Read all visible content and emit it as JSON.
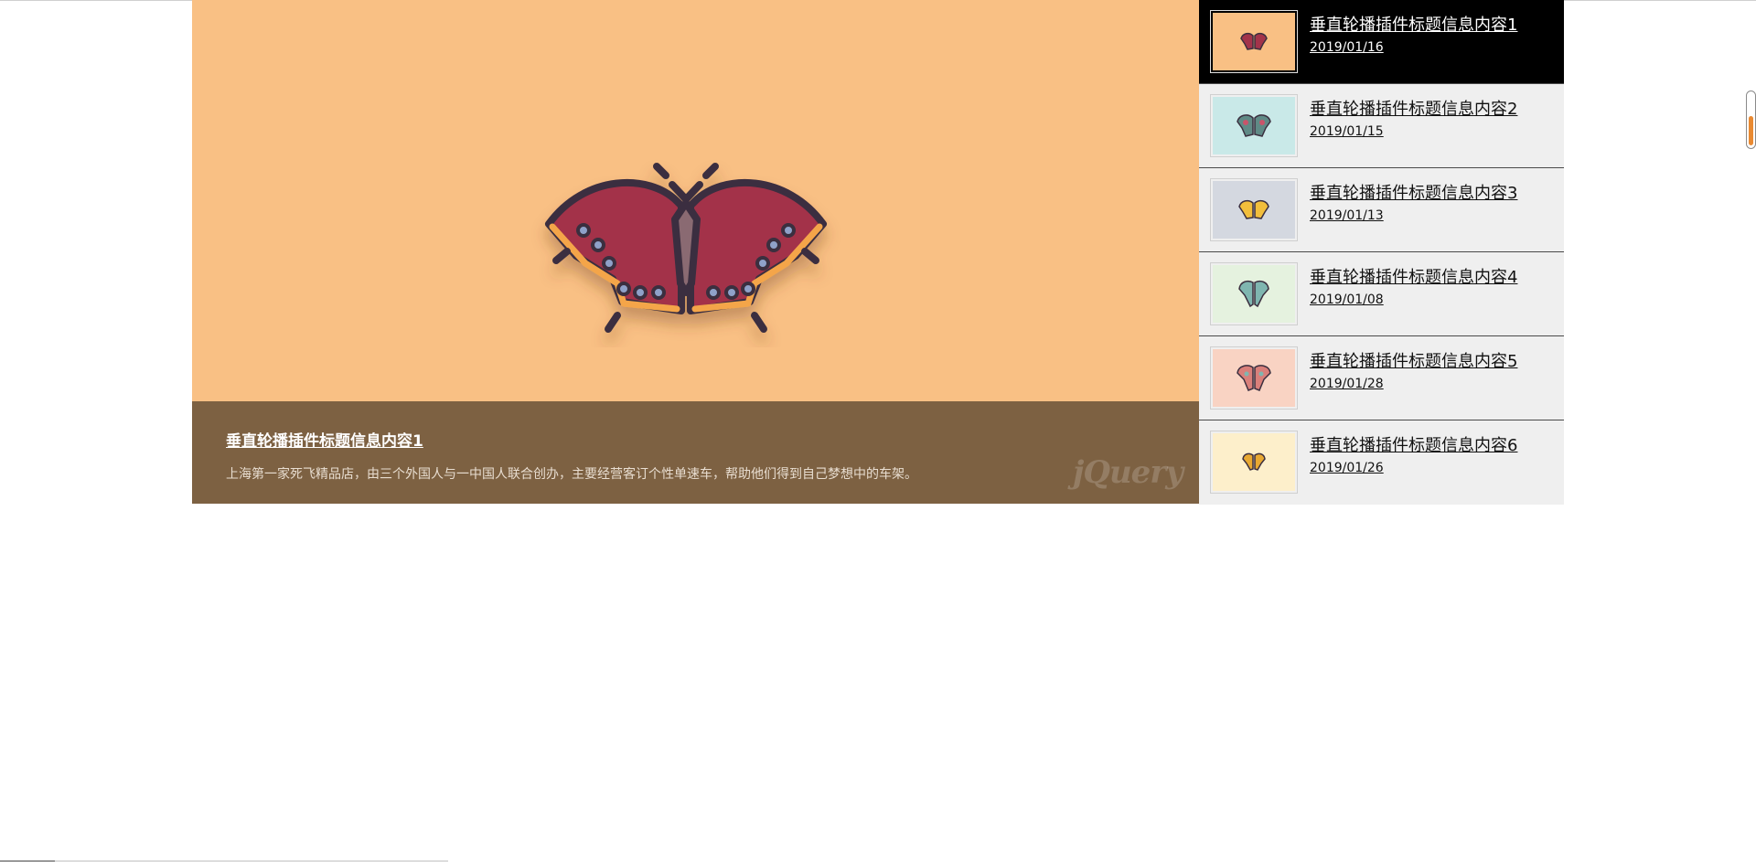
{
  "slider": {
    "main": {
      "image_icon": "butterfly-icon",
      "background": "#f9c084",
      "caption_bg": "#7d6142",
      "title": "垂直轮播插件标题信息内容1",
      "description": "上海第一家死飞精品店，由三个外国人与一中国人联合创办，主要经营客订个性单速车，帮助他们得到自己梦想中的车架。",
      "watermark": "jQuery"
    },
    "items": [
      {
        "title": "垂直轮播插件标题信息内容1",
        "date": "2019/01/16",
        "thumb_bg": "#f9c084",
        "icon": "butterfly-icon",
        "active": true
      },
      {
        "title": "垂直轮播插件标题信息内容2",
        "date": "2019/01/15",
        "thumb_bg": "#c9e9e8",
        "icon": "butterfly-icon",
        "active": false
      },
      {
        "title": "垂直轮播插件标题信息内容3",
        "date": "2019/01/13",
        "thumb_bg": "#d4d8e0",
        "icon": "butterfly-icon",
        "active": false
      },
      {
        "title": "垂直轮播插件标题信息内容4",
        "date": "2019/01/08",
        "thumb_bg": "#e5f2df",
        "icon": "butterfly-icon",
        "active": false
      },
      {
        "title": "垂直轮播插件标题信息内容5",
        "date": "2019/01/28",
        "thumb_bg": "#f9d3c3",
        "icon": "butterfly-icon",
        "active": false
      },
      {
        "title": "垂直轮播插件标题信息内容6",
        "date": "2019/01/26",
        "thumb_bg": "#fdefcb",
        "icon": "butterfly-icon",
        "active": false
      }
    ]
  }
}
